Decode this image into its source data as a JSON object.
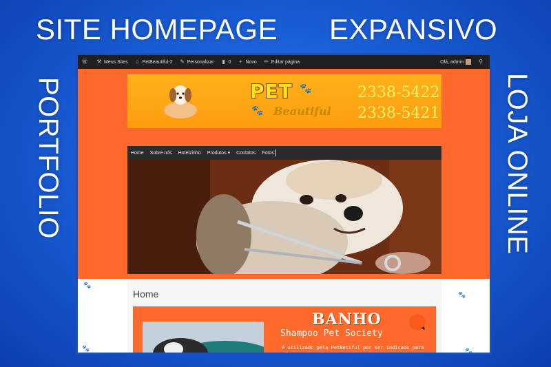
{
  "overlay": {
    "top_left": "SITE HOMEPAGE",
    "top_right": "EXPANSIVO",
    "left_vertical": "PORTFOLIO",
    "right_vertical": "LOJA ONLINE"
  },
  "admin_bar": {
    "items": [
      "Meus Sites",
      "PetBeautiful-2",
      "Personalizar",
      "0",
      "Novo",
      "Editar página"
    ],
    "greeting": "Olá, admin"
  },
  "header": {
    "brand_pet": "PET",
    "brand_name": "Beautiful",
    "phone_1": "2338-5422",
    "phone_2": "2338-5421"
  },
  "nav": {
    "items": [
      "Home",
      "Sobre nós",
      "Hotelzinho",
      "Produtos ▾",
      "Contatos",
      "Fotos"
    ]
  },
  "content": {
    "page_title": "Home",
    "promo_title": "BANHO",
    "promo_subtitle": "Shampoo Pet Society",
    "promo_text": "é utilizado pela PetBetiful por ser indicado para cães e gatos de todas as"
  },
  "colors": {
    "background_blue": "#1a5fd8",
    "site_orange": "#ff6a2c",
    "header_gold": "#ffb21a",
    "nav_dark": "#2b2b2b"
  }
}
